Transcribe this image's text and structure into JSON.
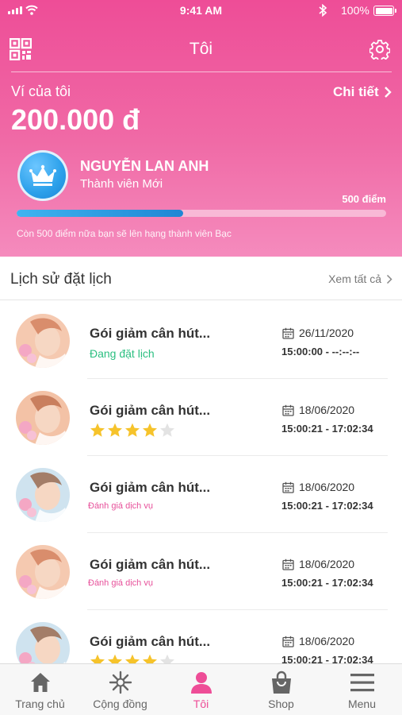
{
  "status_bar": {
    "time": "9:41 AM",
    "battery": "100%"
  },
  "nav": {
    "title": "Tôi"
  },
  "wallet": {
    "label": "Ví của tôi",
    "detail_label": "Chi tiết",
    "amount": "200.000 đ"
  },
  "member": {
    "name": "NGUYỄN LAN ANH",
    "tier": "Thành viên Mới",
    "points": "500 điểm",
    "progress_fraction": 0.45,
    "note": "Còn 500 điểm nữa bạn sẽ lên hạng thành viên Bạc"
  },
  "history": {
    "title": "Lịch sử đặt lịch",
    "see_all": "Xem tất cả",
    "items": [
      {
        "name": "Gói giảm cân hút...",
        "status": "Đang đặt lịch",
        "date": "26/11/2020",
        "time": "15:00:00  -  --:--:--"
      },
      {
        "name": "Gói giảm cân hút...",
        "rating": 4,
        "date": "18/06/2020",
        "time": "15:00:21  -  17:02:34"
      },
      {
        "name": "Gói giảm cân hút...",
        "status": "Đánh giá dịch vụ",
        "date": "18/06/2020",
        "time": "15:00:21  -  17:02:34"
      },
      {
        "name": "Gói giảm cân hút...",
        "status": "Đánh giá dịch vụ",
        "date": "18/06/2020",
        "time": "15:00:21  -  17:02:34"
      },
      {
        "name": "Gói giảm cân hút...",
        "rating": 4,
        "date": "18/06/2020",
        "time": "15:00:21  -  17:02:34"
      }
    ]
  },
  "tabs": [
    {
      "label": "Trang chủ",
      "icon": "home-icon"
    },
    {
      "label": "Cộng đồng",
      "icon": "community-icon"
    },
    {
      "label": "Tôi",
      "icon": "profile-icon",
      "active": true
    },
    {
      "label": "Shop",
      "icon": "shop-bag-icon"
    },
    {
      "label": "Menu",
      "icon": "menu-icon"
    }
  ],
  "colors": {
    "primary": "#ee4d97",
    "booked": "#2bbf80",
    "star": "#f6c32b",
    "progress": "#1f86d4"
  }
}
